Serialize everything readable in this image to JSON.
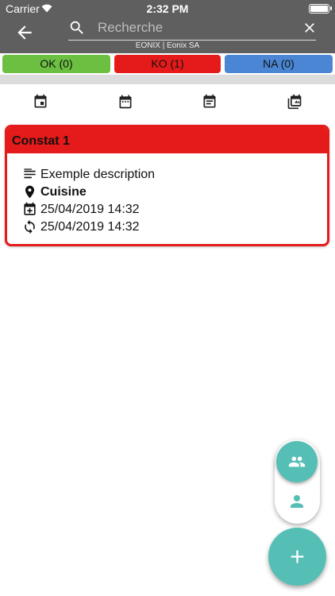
{
  "status_bar": {
    "carrier": "Carrier",
    "time": "2:32 PM"
  },
  "header": {
    "search_placeholder": "Recherche",
    "subtitle": "EONIX | Eonix SA",
    "icons": [
      "arrow-back-icon",
      "search-icon",
      "close-icon"
    ]
  },
  "filters": [
    {
      "label": "OK (0)",
      "color": "#6cc041"
    },
    {
      "label": "KO (1)",
      "color": "#e51a1a"
    },
    {
      "label": "NA (0)",
      "color": "#4a86d3"
    }
  ],
  "sort_icons": [
    "calendar-event-icon",
    "calendar-icon",
    "notes-icon",
    "photo-library-icon"
  ],
  "cards": [
    {
      "title": "Constat 1",
      "status_color": "#e51a1a",
      "description": "Exemple description",
      "location": "Cuisine",
      "created": "25/04/2019 14:32",
      "updated": "25/04/2019 14:32"
    }
  ],
  "fab": {
    "color": "#55bfb5",
    "icons": [
      "group-icon",
      "person-icon",
      "add-icon"
    ]
  }
}
